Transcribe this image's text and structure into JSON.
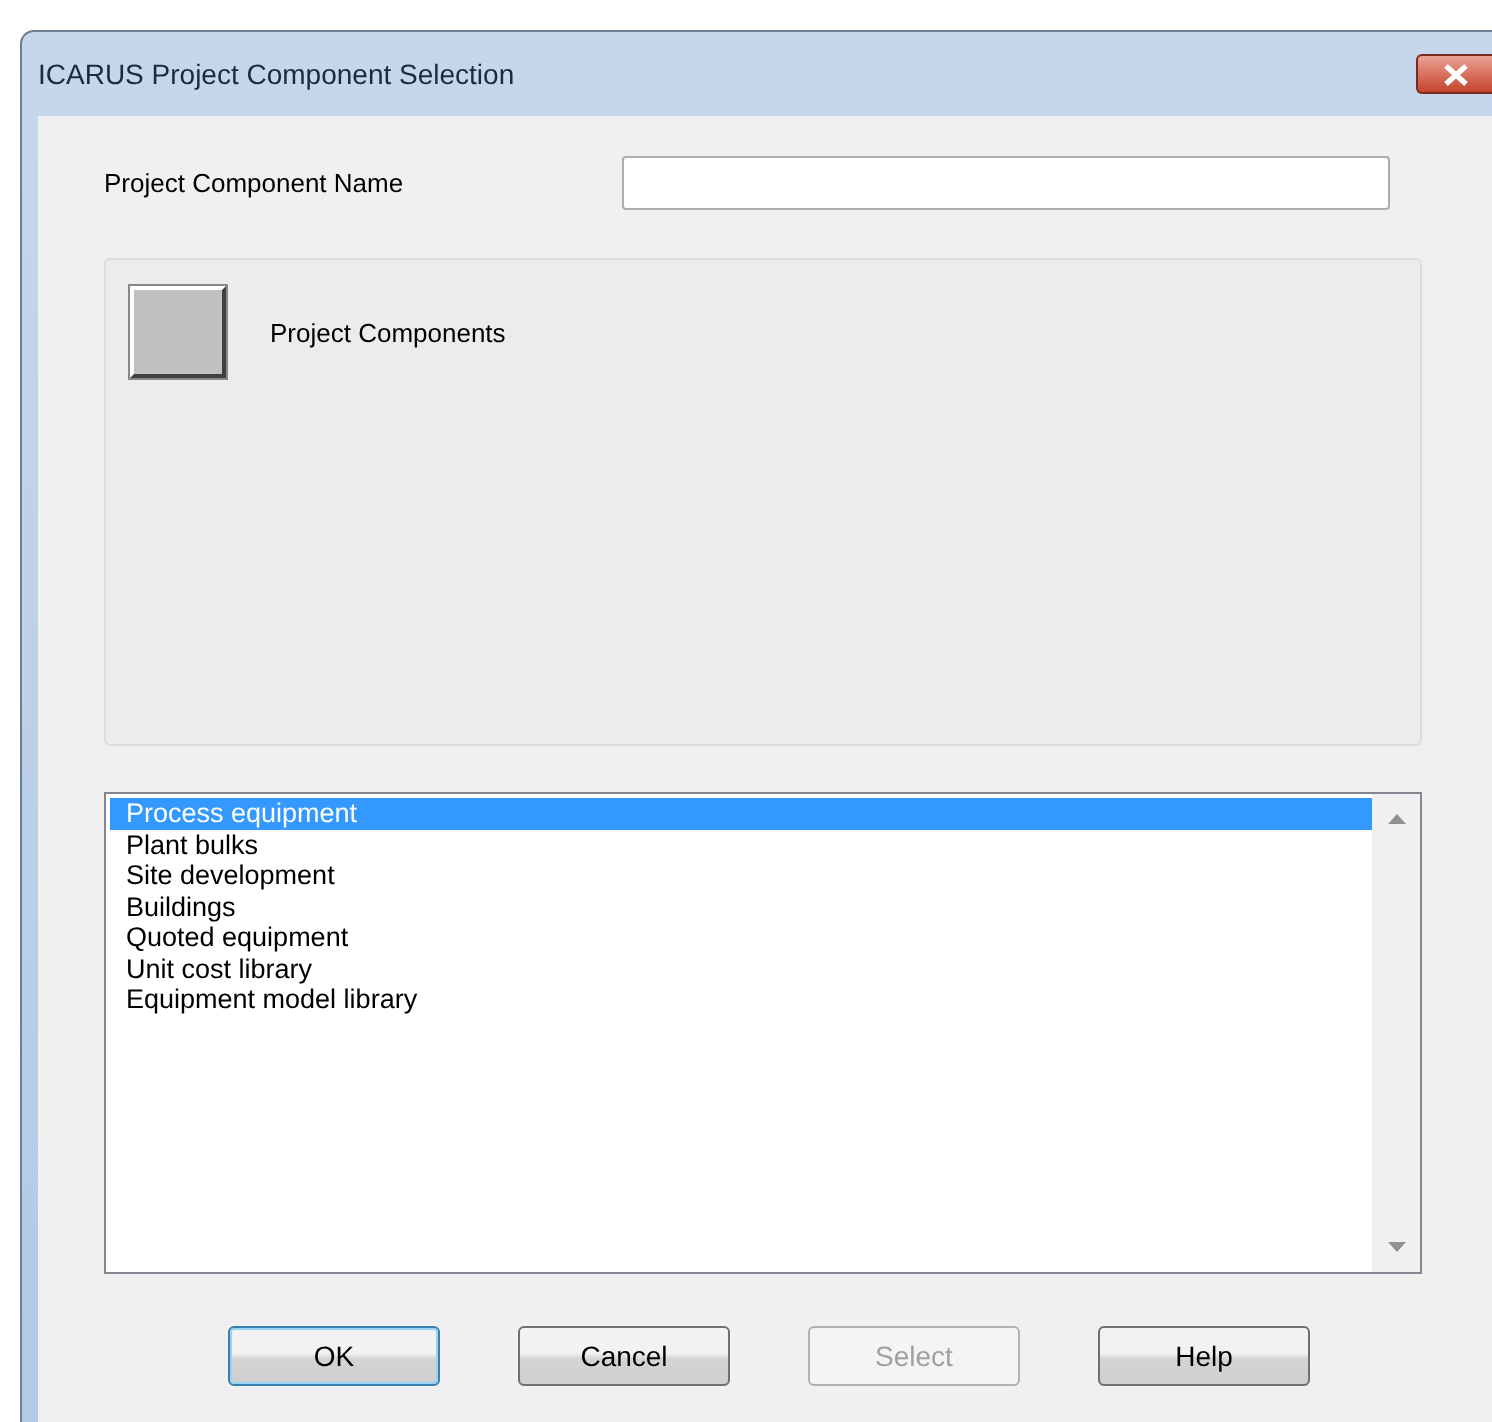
{
  "window": {
    "title": "ICARUS Project Component Selection"
  },
  "name_field": {
    "label": "Project Component Name"
  },
  "panel": {
    "label": "Project Components"
  },
  "list": [
    {
      "label": "Process equipment",
      "selected": true
    },
    {
      "label": "Plant bulks",
      "selected": false
    },
    {
      "label": "Site development",
      "selected": false
    },
    {
      "label": "Buildings",
      "selected": false
    },
    {
      "label": "Quoted equipment",
      "selected": false
    },
    {
      "label": "Unit cost library",
      "selected": false
    },
    {
      "label": "Equipment model library",
      "selected": false
    }
  ],
  "buttons": [
    {
      "label": "OK",
      "disabled": false,
      "default": true
    },
    {
      "label": "Cancel",
      "disabled": false,
      "default": false
    },
    {
      "label": "Select",
      "disabled": true,
      "default": false
    },
    {
      "label": "Help",
      "disabled": false,
      "default": false
    }
  ]
}
